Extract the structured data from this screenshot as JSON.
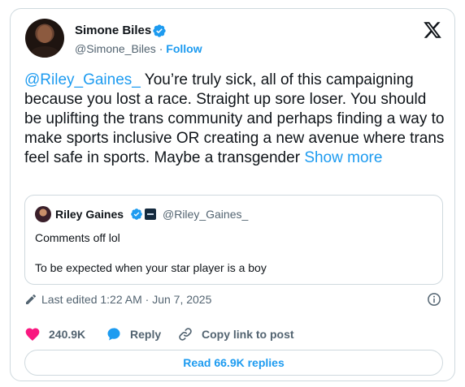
{
  "author": {
    "name": "Simone Biles",
    "handle": "@Simone_Biles",
    "separator": "·",
    "follow_label": "Follow"
  },
  "tweet": {
    "mention": "@Riley_Gaines_",
    "body": " You’re truly sick, all of this campaigning because you lost a race. Straight up sore loser. You should be uplifting the trans community and perhaps finding a way to make sports inclusive OR creating a new avenue where trans feel safe in sports. Maybe a transgender ",
    "show_more": "Show more"
  },
  "quote": {
    "name": "Riley Gaines",
    "handle": "@Riley_Gaines_",
    "line1": "Comments off lol",
    "line2": "To be expected when your star player is a boy"
  },
  "edited": {
    "text": "Last edited 1:22 AM · Jun 7, 2025"
  },
  "actions": {
    "likes": "240.9K",
    "reply_label": "Reply",
    "copy_label": "Copy link to post"
  },
  "replies_button": "Read 66.9K replies",
  "colors": {
    "accent": "#1d9bf0",
    "like": "#f91880",
    "muted": "#536471",
    "text": "#0f1419",
    "border": "#cfd9de"
  },
  "icons": [
    "verified-badge-icon",
    "x-logo-icon",
    "pencil-icon",
    "info-icon",
    "heart-icon",
    "reply-bubble-icon",
    "link-icon"
  ]
}
